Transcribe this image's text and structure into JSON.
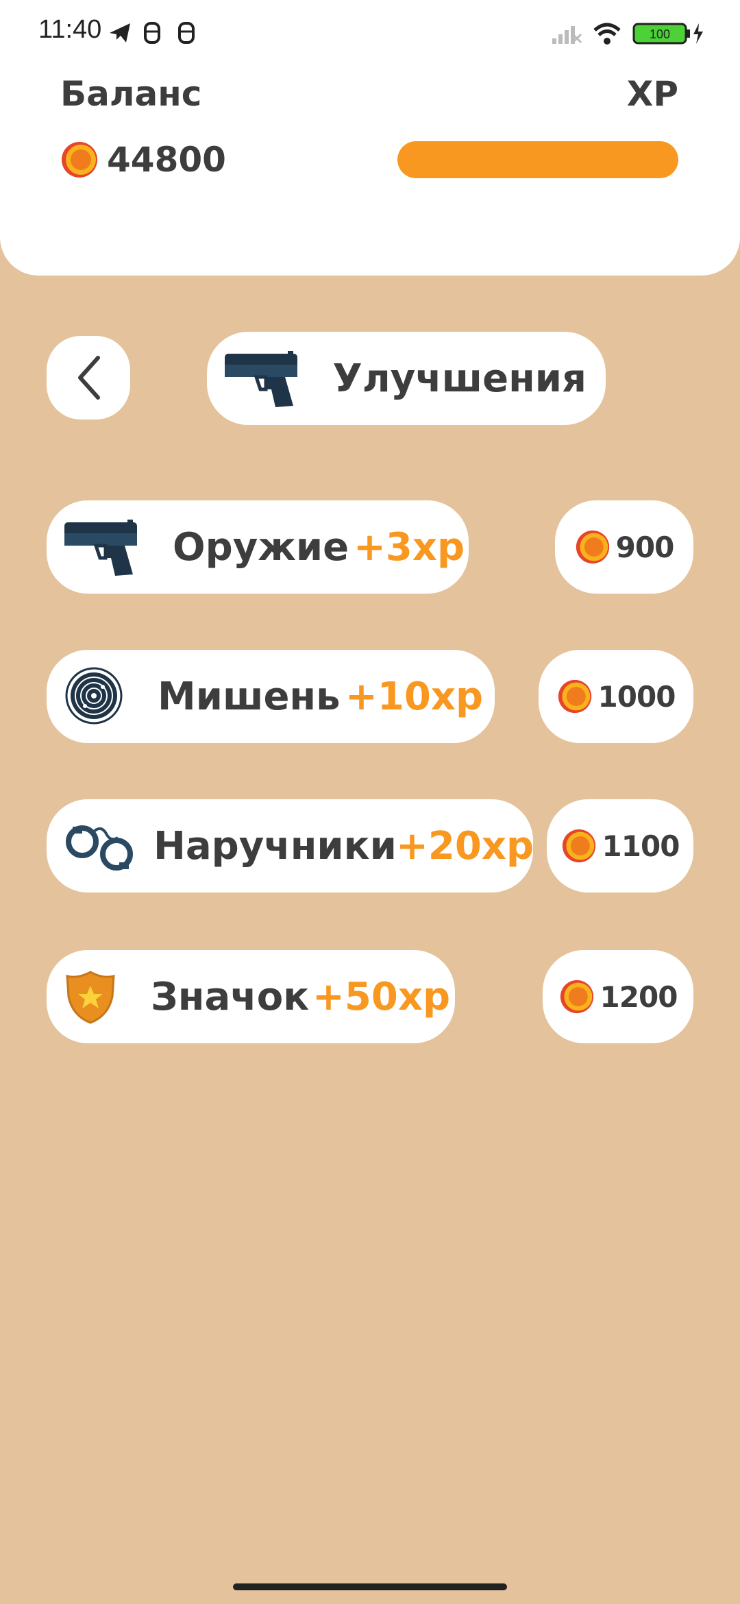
{
  "status_bar": {
    "time": "11:40",
    "battery": "100"
  },
  "header": {
    "balance_label": "Баланс",
    "balance_value": "44800",
    "xp_label": "XP",
    "xp_progress": 1.0
  },
  "nav": {
    "title": "Улучшения"
  },
  "upgrades": [
    {
      "name": "Оружие",
      "xp": "+3xp",
      "price": "900",
      "icon": "pistol-icon"
    },
    {
      "name": "Мишень",
      "xp": "+10xp",
      "price": "1000",
      "icon": "target-icon"
    },
    {
      "name": "Наручники",
      "xp": "+20xp",
      "price": "1100",
      "icon": "handcuffs-icon"
    },
    {
      "name": "Значок",
      "xp": "+50xp",
      "price": "1200",
      "icon": "badge-icon"
    }
  ],
  "colors": {
    "background": "#e3c29c",
    "accent": "#f99820",
    "card": "#ffffff",
    "text": "#3d3d3d"
  }
}
